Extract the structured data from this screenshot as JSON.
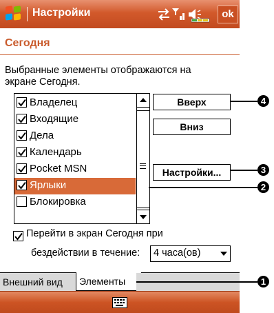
{
  "titlebar": {
    "title": "Настройки",
    "ok_label": "ok",
    "brand_color": "#d2592b",
    "status_icons": [
      "connectivity-icon",
      "signal-icon",
      "speaker-icon",
      "battery-icon"
    ]
  },
  "page": {
    "title": "Сегодня",
    "description": "Выбранные элементы отображаются на экране Сегодня."
  },
  "items": [
    {
      "label": "Владелец",
      "checked": true
    },
    {
      "label": "Входящие",
      "checked": true
    },
    {
      "label": "Дела",
      "checked": true
    },
    {
      "label": "Календарь",
      "checked": true
    },
    {
      "label": "Pocket MSN",
      "checked": true
    },
    {
      "label": "Ярлыки",
      "checked": true,
      "selected": true
    },
    {
      "label": "Блокировка",
      "checked": false
    }
  ],
  "buttons": {
    "up": "Вверх",
    "down": "Вниз",
    "settings": "Настройки..."
  },
  "goto_today": {
    "label": "Перейти в экран Сегодня при",
    "checked": true,
    "inactive_label": "бездействии в течение:",
    "timeout_value": "4 часа(ов)"
  },
  "tabs": [
    "Внешний вид",
    "Элементы"
  ],
  "callouts": [
    "1",
    "2",
    "3",
    "4"
  ]
}
